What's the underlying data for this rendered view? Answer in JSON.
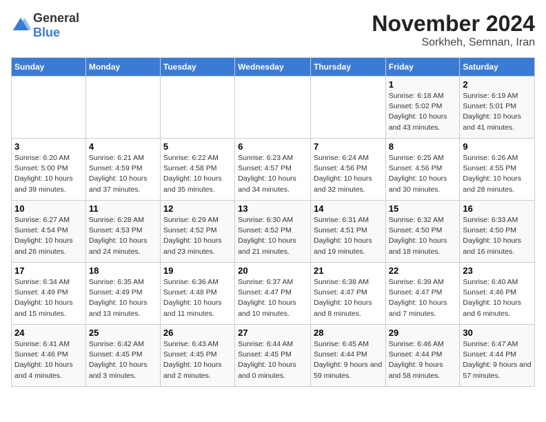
{
  "header": {
    "logo_general": "General",
    "logo_blue": "Blue",
    "month_title": "November 2024",
    "location": "Sorkheh, Semnan, Iran"
  },
  "days_of_week": [
    "Sunday",
    "Monday",
    "Tuesday",
    "Wednesday",
    "Thursday",
    "Friday",
    "Saturday"
  ],
  "weeks": [
    [
      {
        "day": "",
        "content": ""
      },
      {
        "day": "",
        "content": ""
      },
      {
        "day": "",
        "content": ""
      },
      {
        "day": "",
        "content": ""
      },
      {
        "day": "",
        "content": ""
      },
      {
        "day": "1",
        "content": "Sunrise: 6:18 AM\nSunset: 5:02 PM\nDaylight: 10 hours\nand 43 minutes."
      },
      {
        "day": "2",
        "content": "Sunrise: 6:19 AM\nSunset: 5:01 PM\nDaylight: 10 hours\nand 41 minutes."
      }
    ],
    [
      {
        "day": "3",
        "content": "Sunrise: 6:20 AM\nSunset: 5:00 PM\nDaylight: 10 hours\nand 39 minutes."
      },
      {
        "day": "4",
        "content": "Sunrise: 6:21 AM\nSunset: 4:59 PM\nDaylight: 10 hours\nand 37 minutes."
      },
      {
        "day": "5",
        "content": "Sunrise: 6:22 AM\nSunset: 4:58 PM\nDaylight: 10 hours\nand 35 minutes."
      },
      {
        "day": "6",
        "content": "Sunrise: 6:23 AM\nSunset: 4:57 PM\nDaylight: 10 hours\nand 34 minutes."
      },
      {
        "day": "7",
        "content": "Sunrise: 6:24 AM\nSunset: 4:56 PM\nDaylight: 10 hours\nand 32 minutes."
      },
      {
        "day": "8",
        "content": "Sunrise: 6:25 AM\nSunset: 4:56 PM\nDaylight: 10 hours\nand 30 minutes."
      },
      {
        "day": "9",
        "content": "Sunrise: 6:26 AM\nSunset: 4:55 PM\nDaylight: 10 hours\nand 28 minutes."
      }
    ],
    [
      {
        "day": "10",
        "content": "Sunrise: 6:27 AM\nSunset: 4:54 PM\nDaylight: 10 hours\nand 26 minutes."
      },
      {
        "day": "11",
        "content": "Sunrise: 6:28 AM\nSunset: 4:53 PM\nDaylight: 10 hours\nand 24 minutes."
      },
      {
        "day": "12",
        "content": "Sunrise: 6:29 AM\nSunset: 4:52 PM\nDaylight: 10 hours\nand 23 minutes."
      },
      {
        "day": "13",
        "content": "Sunrise: 6:30 AM\nSunset: 4:52 PM\nDaylight: 10 hours\nand 21 minutes."
      },
      {
        "day": "14",
        "content": "Sunrise: 6:31 AM\nSunset: 4:51 PM\nDaylight: 10 hours\nand 19 minutes."
      },
      {
        "day": "15",
        "content": "Sunrise: 6:32 AM\nSunset: 4:50 PM\nDaylight: 10 hours\nand 18 minutes."
      },
      {
        "day": "16",
        "content": "Sunrise: 6:33 AM\nSunset: 4:50 PM\nDaylight: 10 hours\nand 16 minutes."
      }
    ],
    [
      {
        "day": "17",
        "content": "Sunrise: 6:34 AM\nSunset: 4:49 PM\nDaylight: 10 hours\nand 15 minutes."
      },
      {
        "day": "18",
        "content": "Sunrise: 6:35 AM\nSunset: 4:49 PM\nDaylight: 10 hours\nand 13 minutes."
      },
      {
        "day": "19",
        "content": "Sunrise: 6:36 AM\nSunset: 4:48 PM\nDaylight: 10 hours\nand 11 minutes."
      },
      {
        "day": "20",
        "content": "Sunrise: 6:37 AM\nSunset: 4:47 PM\nDaylight: 10 hours\nand 10 minutes."
      },
      {
        "day": "21",
        "content": "Sunrise: 6:38 AM\nSunset: 4:47 PM\nDaylight: 10 hours\nand 8 minutes."
      },
      {
        "day": "22",
        "content": "Sunrise: 6:39 AM\nSunset: 4:47 PM\nDaylight: 10 hours\nand 7 minutes."
      },
      {
        "day": "23",
        "content": "Sunrise: 6:40 AM\nSunset: 4:46 PM\nDaylight: 10 hours\nand 6 minutes."
      }
    ],
    [
      {
        "day": "24",
        "content": "Sunrise: 6:41 AM\nSunset: 4:46 PM\nDaylight: 10 hours\nand 4 minutes."
      },
      {
        "day": "25",
        "content": "Sunrise: 6:42 AM\nSunset: 4:45 PM\nDaylight: 10 hours\nand 3 minutes."
      },
      {
        "day": "26",
        "content": "Sunrise: 6:43 AM\nSunset: 4:45 PM\nDaylight: 10 hours\nand 2 minutes."
      },
      {
        "day": "27",
        "content": "Sunrise: 6:44 AM\nSunset: 4:45 PM\nDaylight: 10 hours\nand 0 minutes."
      },
      {
        "day": "28",
        "content": "Sunrise: 6:45 AM\nSunset: 4:44 PM\nDaylight: 9 hours\nand 59 minutes."
      },
      {
        "day": "29",
        "content": "Sunrise: 6:46 AM\nSunset: 4:44 PM\nDaylight: 9 hours\nand 58 minutes."
      },
      {
        "day": "30",
        "content": "Sunrise: 6:47 AM\nSunset: 4:44 PM\nDaylight: 9 hours\nand 57 minutes."
      }
    ]
  ]
}
